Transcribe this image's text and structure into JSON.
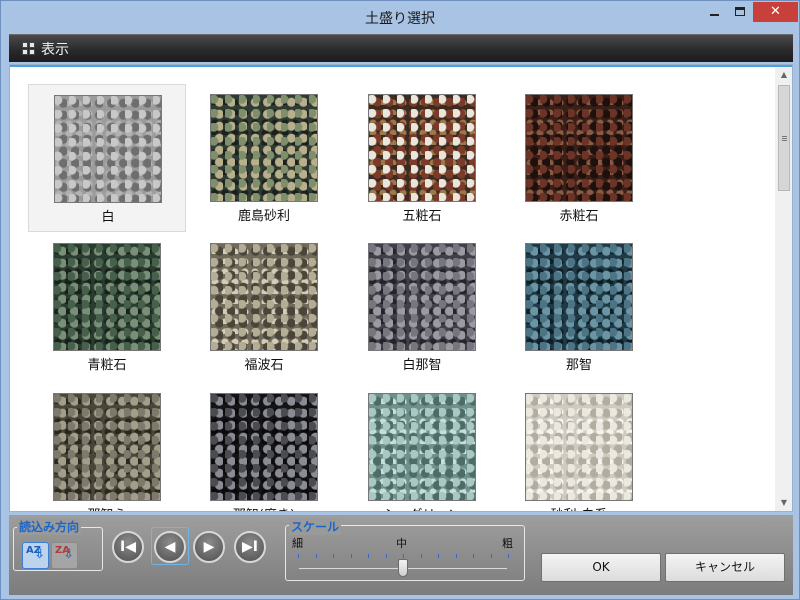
{
  "window": {
    "title": "土盛り選択",
    "close_glyph": "✕"
  },
  "toolbar": {
    "view_label": "表示"
  },
  "gallery": {
    "items": [
      {
        "label": "白",
        "selected": true,
        "base": "#9b9b9b",
        "dots": [
          "#c8c8c8",
          "#6e6e6e",
          "#b2b2b2"
        ]
      },
      {
        "label": "鹿島砂利",
        "selected": false,
        "base": "#2f3a33",
        "dots": [
          "#7f8f6b",
          "#b8b08d",
          "#1a201c"
        ]
      },
      {
        "label": "五粧石",
        "selected": false,
        "base": "#3a2a22",
        "dots": [
          "#e9e6dc",
          "#7b3a2a",
          "#9b7a4a"
        ]
      },
      {
        "label": "赤粧石",
        "selected": false,
        "base": "#3a1f18",
        "dots": [
          "#6b3426",
          "#1e110d",
          "#8b5a44"
        ]
      },
      {
        "label": "青粧石",
        "selected": false,
        "base": "#2a3b30",
        "dots": [
          "#46604c",
          "#7a8f78",
          "#17211a"
        ]
      },
      {
        "label": "福波石",
        "selected": false,
        "base": "#6f6a5a",
        "dots": [
          "#b3ad96",
          "#4a4538",
          "#d2cdb9"
        ]
      },
      {
        "label": "白那智",
        "selected": false,
        "base": "#3f3f47",
        "dots": [
          "#77767f",
          "#9b9aa3",
          "#23232a"
        ]
      },
      {
        "label": "那智",
        "selected": false,
        "base": "#1f3a46",
        "dots": [
          "#4d7484",
          "#6b95a3",
          "#0e1e25"
        ]
      },
      {
        "label": "那智ら",
        "selected": false,
        "base": "#4a4539",
        "dots": [
          "#7d7a6c",
          "#a39e8a",
          "#2a2720"
        ]
      },
      {
        "label": "那智(磨き)",
        "selected": false,
        "base": "#141417",
        "dots": [
          "#4b4b52",
          "#8b8b93",
          "#0a0a0c"
        ]
      },
      {
        "label": "シーグリーン",
        "selected": false,
        "base": "#6f918c",
        "dots": [
          "#a9c8c2",
          "#4d6b67",
          "#c7ddd8"
        ]
      },
      {
        "label": "砂利-白系",
        "selected": false,
        "base": "#cfcbc1",
        "dots": [
          "#ebe8e0",
          "#b3ada1",
          "#f5f3ee"
        ]
      }
    ]
  },
  "sort_group": {
    "title": "読込み方向",
    "az_label": "AZ",
    "za_label": "ZA",
    "arrow": "⇩"
  },
  "nav": {
    "first": "I◀",
    "prev": "◀",
    "next": "▶",
    "last": "▶I"
  },
  "scale": {
    "title": "スケール",
    "fine": "細",
    "medium": "中",
    "coarse": "粗",
    "level": 0.5
  },
  "buttons": {
    "ok": "OK",
    "cancel": "キャンセル"
  }
}
